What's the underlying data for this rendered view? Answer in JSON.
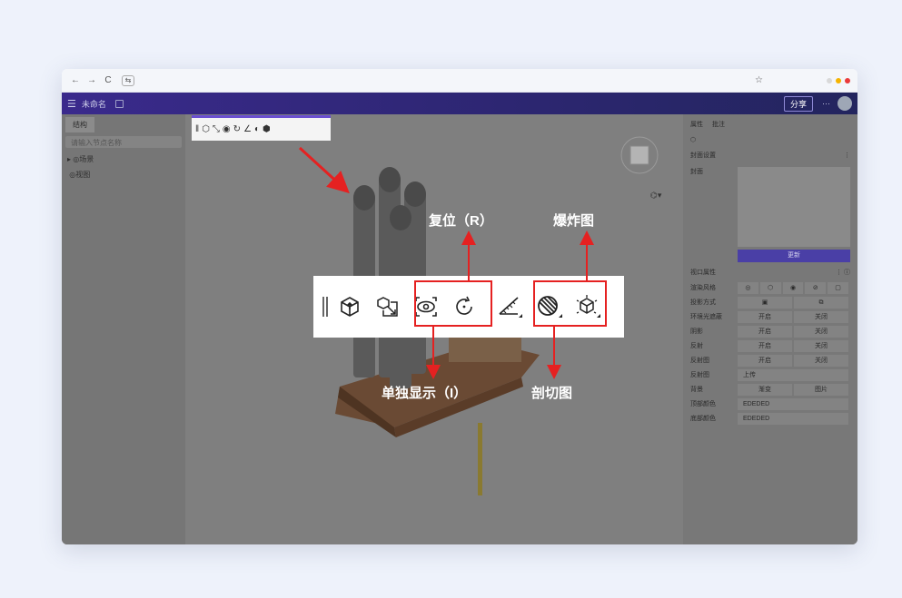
{
  "browser": {
    "nav_back": "←",
    "nav_forward": "→",
    "nav_reload": "C",
    "tab_icon": "⇆",
    "star_icon": "☆",
    "dot_colors": [
      "#d9d9d9",
      "#f5b300",
      "#ea3a3a"
    ]
  },
  "appbar": {
    "menu_icon": "☰",
    "doc_name": "未命名",
    "share_label": "分享",
    "more_label": "···"
  },
  "left_panel": {
    "tab": "结构",
    "search_placeholder": "请输入节点名称",
    "nodes": [
      "场景",
      "视图"
    ]
  },
  "right_panel": {
    "tabs": [
      "属性",
      "批注"
    ],
    "cover_section": "封面设置",
    "cover_label": "封面",
    "update_label": "更新",
    "viewport_section": "视口属性",
    "rows": [
      {
        "k": "渲染风格",
        "type": "icons"
      },
      {
        "k": "投影方式",
        "type": "icons2"
      },
      {
        "k": "环境光遮蔽",
        "a": "开启",
        "b": "关闭"
      },
      {
        "k": "阴影",
        "a": "开启",
        "b": "关闭"
      },
      {
        "k": "反射",
        "a": "开启",
        "b": "关闭"
      },
      {
        "k": "反射图",
        "a": "开启",
        "b": "关闭"
      },
      {
        "k": "反射图",
        "single": "上传"
      },
      {
        "k": "背景",
        "a": "渐变",
        "b": "图片"
      },
      {
        "k": "顶部颜色",
        "single": "EDEDED"
      },
      {
        "k": "底部颜色",
        "single": "EDEDED"
      }
    ]
  },
  "annotations": {
    "reset": "复位（R）",
    "explode": "爆炸图",
    "isolate": "单独显示（I）",
    "section": "剖切图"
  },
  "colors": {
    "accent": "#6a4fd1",
    "annotation_red": "#e52121",
    "appbar": "#2c2670"
  }
}
